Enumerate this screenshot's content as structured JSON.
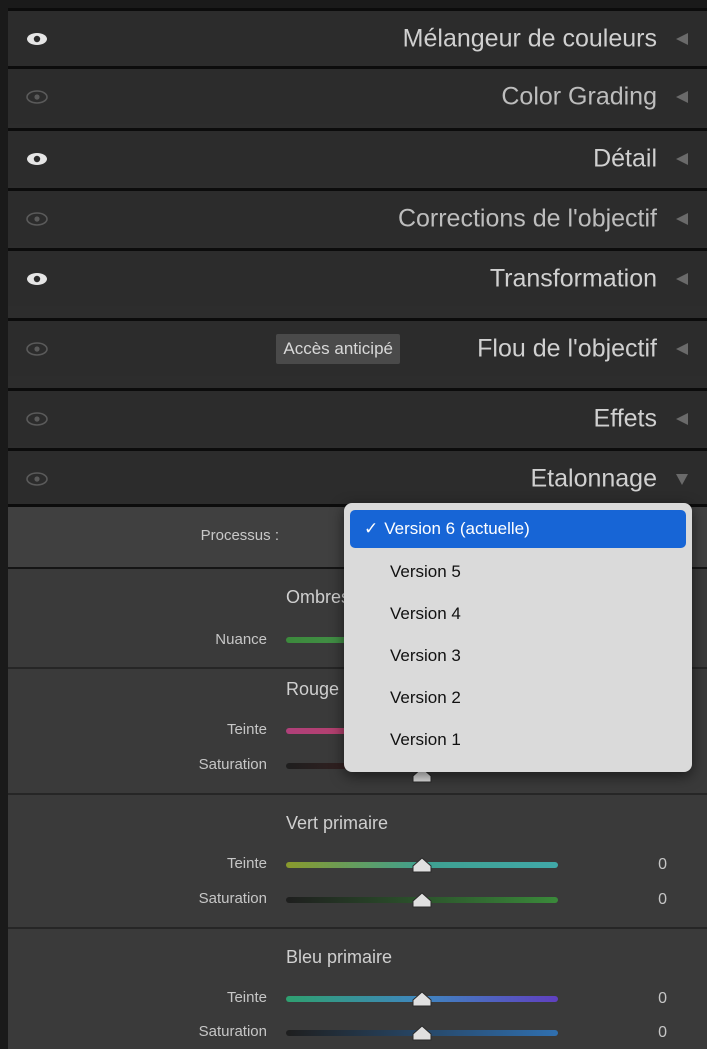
{
  "panels": [
    {
      "title": "Mélangeur de couleurs",
      "eye_visible": true
    },
    {
      "title": "Color Grading",
      "eye_visible": false
    },
    {
      "title": "Détail",
      "eye_visible": true
    },
    {
      "title": "Corrections de l'objectif",
      "eye_visible": false
    },
    {
      "title": "Transformation",
      "eye_visible": true
    },
    {
      "title": "Flou de l'objectif",
      "eye_visible": false,
      "badge": "Accès anticipé"
    },
    {
      "title": "Effets",
      "eye_visible": false
    },
    {
      "title": "Etalonnage",
      "eye_visible": false,
      "expanded": true
    }
  ],
  "calibration": {
    "process_label": "Processus :",
    "shadows": {
      "title": "Ombres",
      "label": "Nuance"
    },
    "red": {
      "title": "Rouge primaire",
      "hue_label": "Teinte",
      "sat_label": "Saturation"
    },
    "green": {
      "title": "Vert primaire",
      "hue_label": "Teinte",
      "sat_label": "Saturation",
      "hue_value": "0",
      "sat_value": "0"
    },
    "blue": {
      "title": "Bleu primaire",
      "hue_label": "Teinte",
      "sat_label": "Saturation",
      "hue_value": "0",
      "sat_value": "0"
    }
  },
  "process_dropdown": {
    "check": "✓",
    "selected": "Version 6 (actuelle)",
    "options": [
      "Version 6 (actuelle)",
      "Version 5",
      "Version 4",
      "Version 3",
      "Version 2",
      "Version 1"
    ]
  },
  "colors": {
    "accent": "#1765d6",
    "panel_bg": "#2c2c2c",
    "content_bg": "#3a3a3a"
  },
  "icons": {
    "eye": "eye-icon",
    "collapse": "collapse-triangle-icon",
    "expand": "expand-triangle-icon",
    "thumb": "slider-thumb-icon"
  }
}
